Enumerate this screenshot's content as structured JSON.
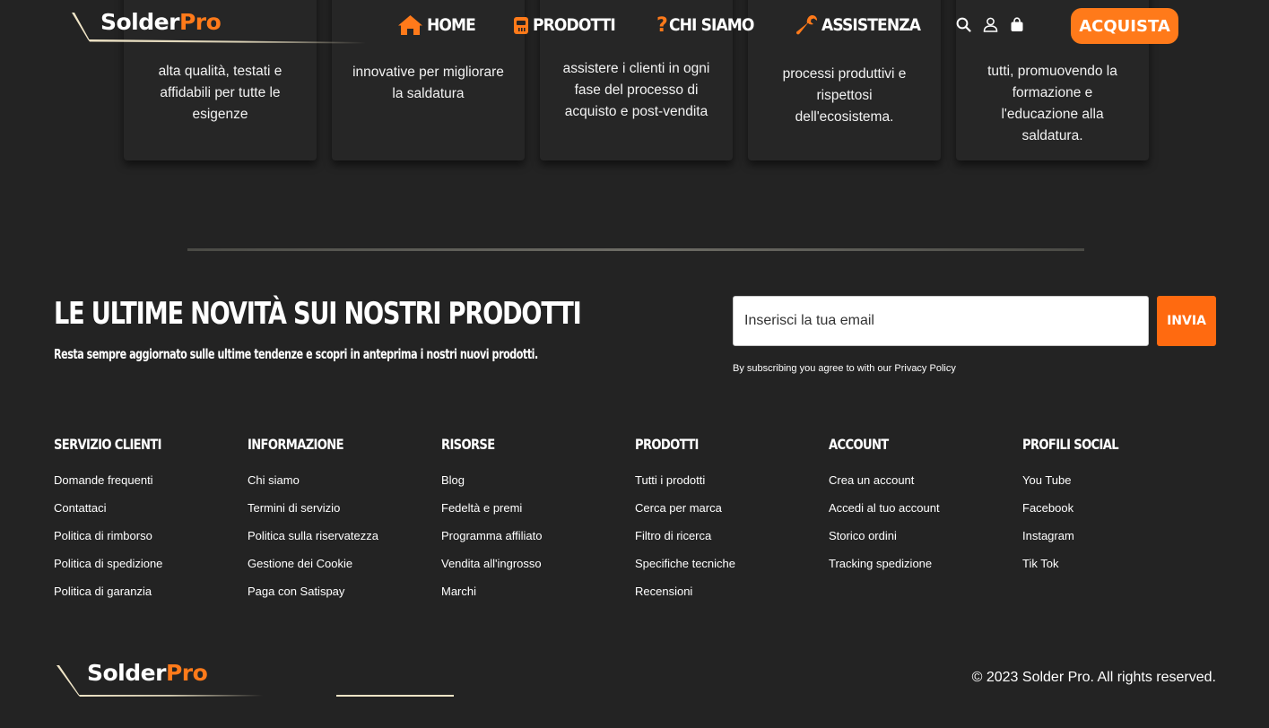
{
  "brand": {
    "name_part1": "Solder",
    "name_part2": "Pro"
  },
  "header": {
    "nav": [
      {
        "label": "HOME",
        "icon": "home-icon"
      },
      {
        "label": "PRODOTTI",
        "icon": "soldering-station-icon"
      },
      {
        "label": "CHI SIAMO",
        "icon": "question-mark-icon",
        "prefix": "?"
      },
      {
        "label": "ASSISTENZA",
        "icon": "wrench-icon"
      }
    ],
    "icons": [
      "search-icon",
      "user-icon",
      "cart-icon"
    ],
    "cta_label": "ACQUISTA"
  },
  "cards": [
    {
      "lines": [
        "alta qualità, testati e",
        "affidabili per tutte le",
        "esigenze"
      ]
    },
    {
      "lines": [
        "innovative per migliorare",
        "la saldatura"
      ]
    },
    {
      "lines": [
        "assistere i clienti in ogni",
        "fase del processo di",
        "acquisto e post-vendita"
      ]
    },
    {
      "lines": [
        "processi produttivi e",
        "rispettosi",
        "dell'ecosistema."
      ]
    },
    {
      "lines": [
        "tutti, promuovendo la",
        "formazione e",
        "l'educazione alla",
        "saldatura."
      ]
    }
  ],
  "newsletter": {
    "title": "LE ULTIME NOVITÀ SUI NOSTRI PRODOTTI",
    "subtitle": "Resta sempre aggiornato sulle ultime tendenze e scopri in anteprima i nostri nuovi prodotti.",
    "email_placeholder": "Inserisci la tua email",
    "email_value": "",
    "submit_label": "INVIA",
    "consent_prefix": "By subscribing you agree to with our ",
    "consent_link": "Privacy Policy"
  },
  "footer_columns": [
    {
      "title": "SERVIZIO CLIENTI",
      "links": [
        "Domande frequenti",
        "Contattaci",
        "Politica di rimborso",
        "Politica di spedizione",
        "Politica di garanzia"
      ]
    },
    {
      "title": "INFORMAZIONE",
      "links": [
        "Chi siamo",
        "Termini di servizio",
        "Politica sulla riservatezza",
        "Gestione dei Cookie",
        "Paga con Satispay"
      ]
    },
    {
      "title": "RISORSE",
      "links": [
        "Blog",
        "Fedeltà e premi",
        "Programma affiliato",
        "Vendita all'ingrosso",
        "Marchi"
      ]
    },
    {
      "title": "PRODOTTI",
      "links": [
        "Tutti i prodotti",
        "Cerca per marca",
        "Filtro di ricerca",
        "Specifiche tecniche",
        "Recensioni"
      ]
    },
    {
      "title": "ACCOUNT",
      "links": [
        "Crea un account",
        "Accedi al tuo account",
        "Storico ordini",
        "Tracking spedizione"
      ]
    },
    {
      "title": "PROFILI SOCIAL",
      "links": [
        "You Tube",
        "Facebook",
        "Instagram",
        "Tik Tok"
      ]
    }
  ],
  "copyright": "© 2023 Solder Pro. All rights reserved.",
  "colors": {
    "background": "#232323",
    "accent": "#ff7a1a",
    "card": "#262626",
    "text": "#ffffff"
  }
}
